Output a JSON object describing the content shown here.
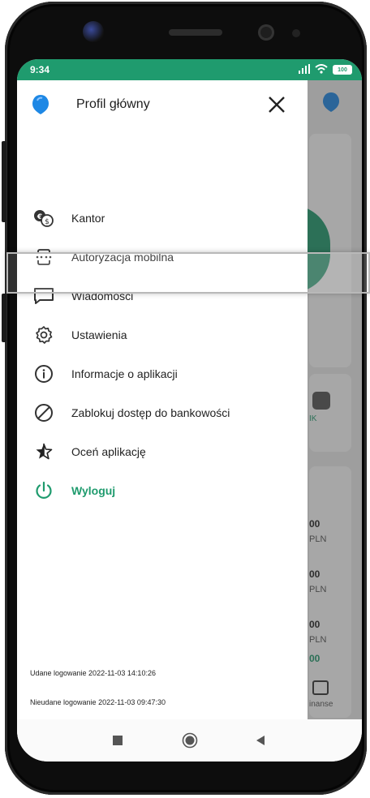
{
  "status_bar": {
    "time": "9:34",
    "battery": "100"
  },
  "drawer": {
    "title": "Profil główny",
    "items": [
      {
        "label": "Kantor",
        "icon": "currency-exchange-icon"
      },
      {
        "label": "Autoryzacja mobilna",
        "icon": "mobile-authorization-icon"
      },
      {
        "label": "Wiadomości",
        "icon": "message-icon"
      },
      {
        "label": "Ustawienia",
        "icon": "gear-icon",
        "highlighted": true
      },
      {
        "label": "Informacje o aplikacji",
        "icon": "info-icon"
      },
      {
        "label": "Zablokuj dostęp do bankowości",
        "icon": "block-icon"
      },
      {
        "label": "Oceń aplikację",
        "icon": "star-icon"
      },
      {
        "label": "Wyloguj",
        "icon": "power-icon"
      }
    ],
    "last_login_success": "Udane logowanie 2022-11-03 14:10:26",
    "last_login_failed": "Nieudane logowanie 2022-11-03 09:47:30"
  },
  "background": {
    "label_ik": "IK",
    "amount_1": "00",
    "currency_1": "PLN",
    "amount_2": "00",
    "currency_2": "PLN",
    "amount_3": "00",
    "currency_3": "PLN",
    "amount_4": "00",
    "tab_label": "inanse"
  },
  "colors": {
    "accent": "#1f9b6e",
    "avatar": "#1e88e5"
  }
}
